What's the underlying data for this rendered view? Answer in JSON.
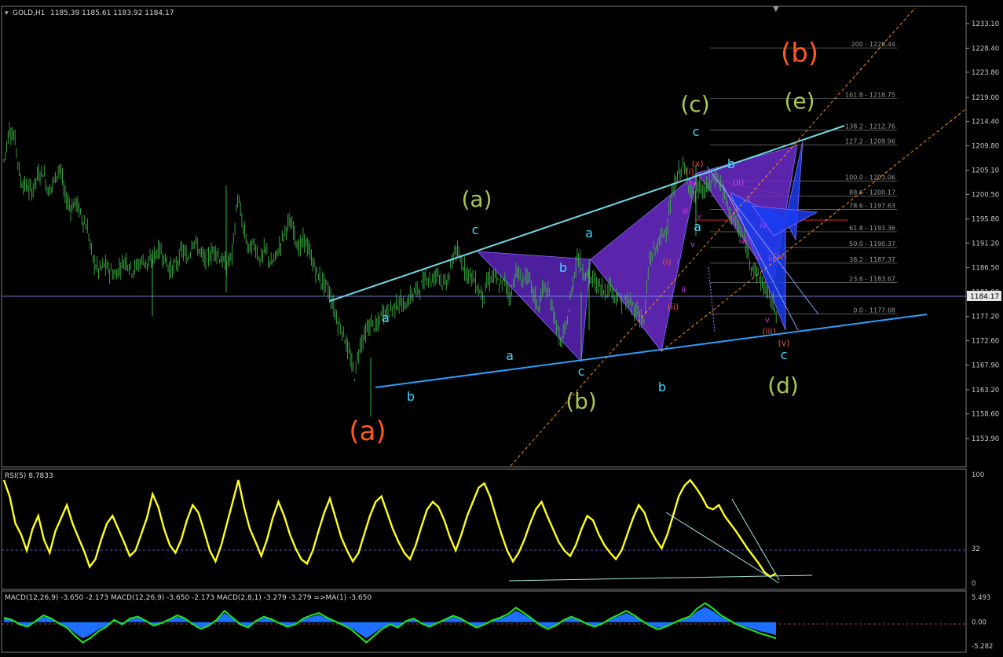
{
  "header": {
    "symbol_label": "GOLD,H1",
    "ohlc": "1185.39 1185.61 1183.92 1184.17"
  },
  "price_axis": {
    "ticks": [
      "1233.10",
      "1228.40",
      "1223.80",
      "1219.00",
      "1214.40",
      "1209.80",
      "1205.10",
      "1200.50",
      "1195.80",
      "1191.20",
      "1186.50",
      "1181.90",
      "1177.20",
      "1172.60",
      "1167.90",
      "1163.20",
      "1158.60",
      "1153.90"
    ],
    "current_price": "1184.17"
  },
  "fib_levels": [
    {
      "label": "200 - 1228.44"
    },
    {
      "label": "161.8 - 1218.75"
    },
    {
      "label": "138.2 - 1212.76"
    },
    {
      "label": "127.2 - 1209.96"
    },
    {
      "label": "100.0 - 1203.06"
    },
    {
      "label": "88.6 - 1200.17"
    },
    {
      "label": "78.6 - 1197.63"
    },
    {
      "label": "61.8 - 1193.36"
    },
    {
      "label": "50.0 - 1190.37"
    },
    {
      "label": "38.2 - 1187.37"
    },
    {
      "label": "23.6 - 1183.67"
    },
    {
      "label": "0.0 - 1177.68"
    }
  ],
  "wave_labels": [
    {
      "text": "(a)"
    },
    {
      "text": "(b)"
    },
    {
      "text": "(a)"
    },
    {
      "text": "(b)"
    },
    {
      "text": "(c)"
    },
    {
      "text": "(d)"
    },
    {
      "text": "(e)"
    },
    {
      "text": "a"
    },
    {
      "text": "b"
    },
    {
      "text": "c"
    },
    {
      "text": "a"
    },
    {
      "text": "b"
    },
    {
      "text": "c"
    },
    {
      "text": "a"
    },
    {
      "text": "b"
    },
    {
      "text": "c"
    },
    {
      "text": "a"
    },
    {
      "text": "b"
    },
    {
      "text": "c"
    },
    {
      "text": "(i)"
    },
    {
      "text": "(ii)"
    },
    {
      "text": "(iii)"
    },
    {
      "text": "(iv)"
    },
    {
      "text": "(v)"
    },
    {
      "text": "(x)"
    },
    {
      "text": "(i)"
    },
    {
      "text": "(ii)"
    },
    {
      "text": "i"
    },
    {
      "text": "ii"
    },
    {
      "text": "iii"
    },
    {
      "text": "iv"
    },
    {
      "text": "v"
    },
    {
      "text": "i"
    },
    {
      "text": "ii"
    },
    {
      "text": "iii"
    },
    {
      "text": "iv"
    },
    {
      "text": "v"
    },
    {
      "text": "v"
    },
    {
      "text": "iii"
    },
    {
      "text": "iv"
    },
    {
      "text": "i"
    }
  ],
  "rsi": {
    "label": "RSI(5) 8.7833",
    "ticks": [
      "100",
      "32",
      "0"
    ]
  },
  "macd": {
    "label": "MACD(12,26,9) -3.650 -2.173  MACD(12,26,9) -3.650 -2.173  MACD(2,8,1) -3.279 -3.279  =>MA(1) -3.650",
    "ticks": [
      "5.493",
      "0.00",
      "-5.282"
    ]
  },
  "colors": {
    "candles": "#3cb043",
    "trend_cyan": "#5ecfe0",
    "trend_blue": "#1e90ff",
    "pattern_purple": "#6a2cc8",
    "pattern_blue": "#1a3cf0",
    "fib_orange": "#ff8c1a",
    "wave_green": "#a8c850",
    "wave_orange": "#ff5a1e",
    "wave_cyan": "#40d8ff",
    "rsi_yellow": "#ffff1a",
    "macd_green": "#22dd22",
    "macd_blue": "#1e6eff"
  },
  "chart_data": [
    {
      "type": "candlestick",
      "title": "GOLD,H1",
      "ylim": [
        1153.9,
        1233.1
      ],
      "trend": [
        1207,
        1213,
        1211,
        1203,
        1202,
        1201,
        1204,
        1205,
        1201,
        1203,
        1206,
        1200,
        1198,
        1199,
        1196,
        1194,
        1188,
        1186,
        1187,
        1186,
        1185,
        1187,
        1188,
        1186,
        1187,
        1188,
        1187,
        1189,
        1190,
        1188,
        1186,
        1187,
        1190,
        1188,
        1192,
        1190,
        1188,
        1189,
        1190,
        1188,
        1187,
        1189,
        1200,
        1194,
        1190,
        1191,
        1188,
        1190,
        1187,
        1189,
        1192,
        1195,
        1194,
        1190,
        1192,
        1189,
        1186,
        1184,
        1183,
        1180,
        1176,
        1174,
        1170,
        1166,
        1172,
        1174,
        1176,
        1175,
        1178,
        1178,
        1179,
        1180,
        1179,
        1181,
        1182,
        1183,
        1185,
        1184,
        1186,
        1183,
        1185,
        1190,
        1188,
        1186,
        1185,
        1183,
        1181,
        1184,
        1185,
        1183,
        1184,
        1181,
        1186,
        1184,
        1185,
        1182,
        1179,
        1183,
        1181,
        1177,
        1172,
        1175,
        1182,
        1189,
        1186,
        1185,
        1184,
        1183,
        1182,
        1183,
        1181,
        1180,
        1180,
        1179,
        1178,
        1176,
        1188,
        1190,
        1192,
        1194,
        1200,
        1204,
        1206,
        1203,
        1200,
        1202,
        1201,
        1203,
        1204,
        1202,
        1198,
        1196,
        1194,
        1192,
        1188,
        1186,
        1184,
        1182,
        1180,
        1178
      ],
      "fib_levels": [
        1228.44,
        1218.75,
        1212.76,
        1209.96,
        1203.06,
        1200.17,
        1197.63,
        1193.36,
        1190.37,
        1187.37,
        1183.67,
        1177.68
      ]
    },
    {
      "type": "line",
      "title": "RSI(5) 8.7833",
      "ylim": [
        0,
        100
      ],
      "values": [
        95,
        80,
        55,
        45,
        30,
        50,
        62,
        40,
        28,
        48,
        60,
        72,
        55,
        42,
        30,
        15,
        22,
        40,
        55,
        62,
        50,
        38,
        25,
        30,
        45,
        60,
        82,
        70,
        50,
        35,
        28,
        40,
        58,
        72,
        65,
        48,
        30,
        20,
        35,
        55,
        75,
        95,
        70,
        50,
        38,
        25,
        40,
        60,
        75,
        62,
        45,
        32,
        22,
        18,
        30,
        48,
        65,
        78,
        60,
        42,
        30,
        20,
        28,
        45,
        62,
        75,
        80,
        65,
        50,
        38,
        28,
        22,
        35,
        52,
        68,
        75,
        70,
        58,
        42,
        30,
        45,
        62,
        75,
        88,
        92,
        80,
        62,
        45,
        30,
        20,
        28,
        40,
        55,
        68,
        75,
        62,
        50,
        38,
        30,
        25,
        35,
        50,
        62,
        58,
        45,
        35,
        28,
        22,
        30,
        45,
        60,
        72,
        65,
        50,
        40,
        32,
        45,
        62,
        80,
        90,
        95,
        88,
        80,
        70,
        68,
        72,
        62,
        55,
        48,
        40,
        32,
        25,
        18,
        10,
        6,
        9
      ]
    },
    {
      "type": "line",
      "title": "MACD(2,8,1)",
      "ylim": [
        -5.282,
        5.493
      ],
      "values": [
        1,
        0.5,
        -0.5,
        -1,
        0.2,
        1.5,
        0.8,
        -0.3,
        -1.2,
        -3,
        -4.5,
        -3.5,
        -2,
        -1,
        0.5,
        -0.5,
        0.8,
        1.2,
        0.3,
        -0.8,
        -0.2,
        0.6,
        1.5,
        0.8,
        -0.5,
        -1.5,
        -0.8,
        0.5,
        2.5,
        1,
        -0.5,
        -1.2,
        0.3,
        1.2,
        0.6,
        -0.3,
        -1,
        -0.5,
        0.8,
        1.5,
        2,
        1,
        0.2,
        -0.6,
        -1.5,
        -3,
        -4.5,
        -3,
        -1.5,
        -0.5,
        -1.2,
        0.2,
        0.8,
        -0.3,
        -1,
        -0.2,
        0.6,
        1.4,
        0.8,
        -0.3,
        -1.2,
        -0.5,
        0.4,
        1,
        1.8,
        3.2,
        2,
        0.8,
        -0.6,
        -1.5,
        -0.8,
        0.4,
        1.2,
        0.5,
        -0.4,
        -1,
        -0.3,
        0.8,
        1.6,
        2.5,
        1.5,
        0.3,
        -0.8,
        -1.6,
        -1,
        -0.2,
        0.6,
        1.2,
        3,
        4.2,
        3,
        1.5,
        0.5,
        -0.5,
        -1.2,
        -1.8,
        -2.5,
        -3,
        -3.6
      ]
    }
  ]
}
